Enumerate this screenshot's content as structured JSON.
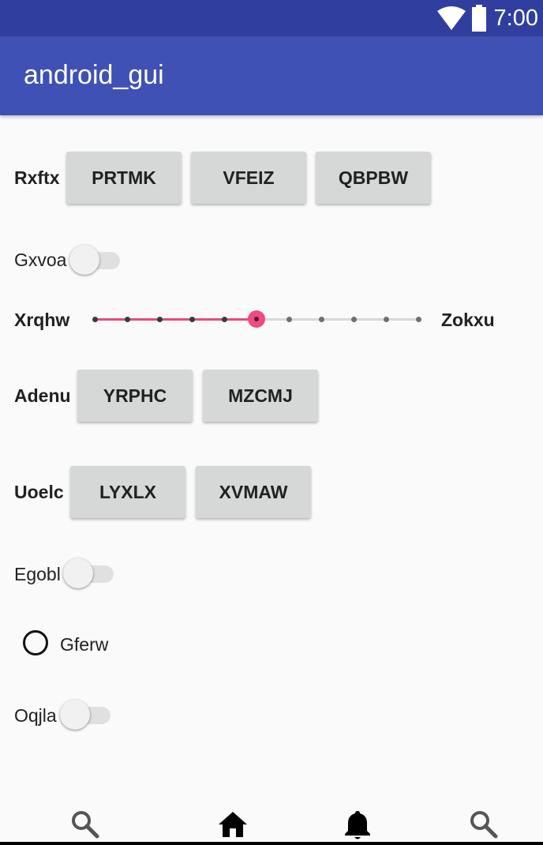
{
  "status": {
    "time": "7:00"
  },
  "appbar": {
    "title": "android_gui"
  },
  "row1": {
    "label": "Rxftx",
    "buttons": [
      "PRTMK",
      "VFEIZ",
      "QBPBW"
    ]
  },
  "switch1": {
    "label": "Gxvoa",
    "checked": false
  },
  "slider": {
    "start_label": "Xrqhw",
    "end_label": "Zokxu",
    "steps": 10,
    "value": 5
  },
  "row2": {
    "label": "Adenu",
    "buttons": [
      "YRPHC",
      "MZCMJ"
    ]
  },
  "row3": {
    "label": "Uoelc",
    "buttons": [
      "LYXLX",
      "XVMAW"
    ]
  },
  "switch2": {
    "label": "Egobl",
    "checked": false
  },
  "radio": {
    "label": "Gferw",
    "checked": false
  },
  "switch3": {
    "label": "Oqjla",
    "checked": false
  },
  "bottom_nav": {
    "items": [
      "search-icon",
      "home-icon",
      "bell-icon",
      "search-icon"
    ]
  },
  "colors": {
    "status_bar": "#303f9f",
    "app_bar": "#3f51b5",
    "accent": "#ee4a84"
  }
}
